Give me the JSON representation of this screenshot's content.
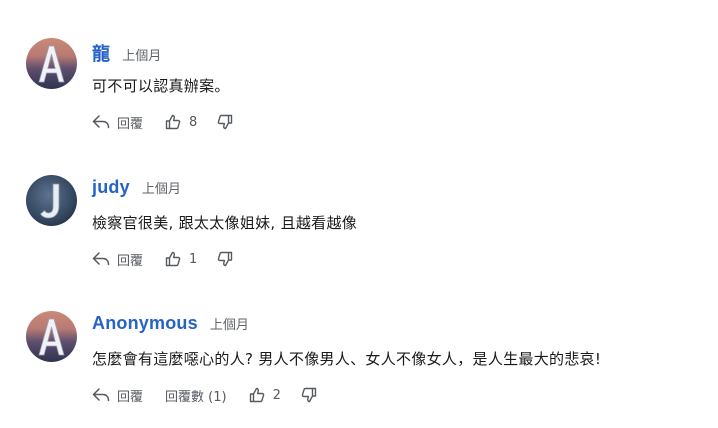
{
  "comments": [
    {
      "author": "龍",
      "avatar_letter": "A",
      "avatar_icon": "letter-a-avatar",
      "time": "上個月",
      "text": "可不可以認真辦案。",
      "reply_label": "回覆",
      "likes": "8",
      "replies_label": null
    },
    {
      "author": "judy",
      "avatar_letter": "J",
      "avatar_icon": "letter-j-avatar",
      "time": "上個月",
      "text": "檢察官很美, 跟太太像姐妹, 且越看越像",
      "reply_label": "回覆",
      "likes": "1",
      "replies_label": null
    },
    {
      "author": "Anonymous",
      "avatar_letter": "A",
      "avatar_icon": "letter-a-avatar",
      "time": "上個月",
      "text": "怎麼會有這麼噁心的人? 男人不像男人、女人不像女人，是人生最大的悲哀!",
      "reply_label": "回覆",
      "replies_label": "回覆數 (1)",
      "likes": "2"
    }
  ],
  "icons": {
    "reply": "reply-arrow-icon",
    "like": "thumbs-up-icon",
    "dislike": "thumbs-down-icon"
  },
  "colors": {
    "author": "#2563c9",
    "meta": "#5f6368",
    "text": "#1a1a1a"
  }
}
